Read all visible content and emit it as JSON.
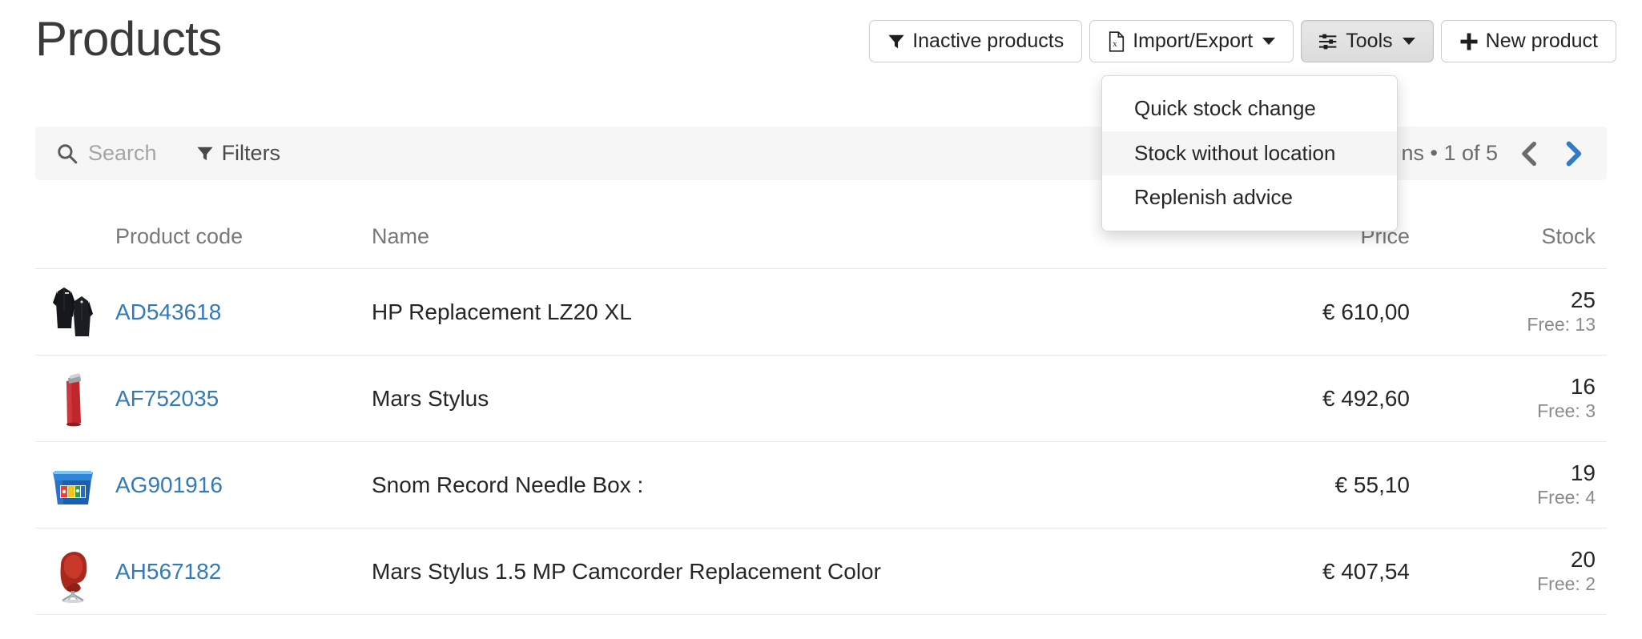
{
  "header": {
    "title": "Products",
    "buttons": [
      {
        "label": "Inactive products",
        "icon": "filter-icon"
      },
      {
        "label": "Import/Export",
        "icon": "excel-file-icon",
        "caret": true
      },
      {
        "label": "Tools",
        "icon": "sliders-icon",
        "caret": true,
        "active": true
      },
      {
        "label": "New product",
        "icon": "plus-icon"
      }
    ]
  },
  "tools_menu": {
    "items": [
      {
        "label": "Quick stock change",
        "hover": false
      },
      {
        "label": "Stock without location",
        "hover": true
      },
      {
        "label": "Replenish advice",
        "hover": false
      }
    ]
  },
  "toolbar": {
    "search_placeholder": "Search",
    "search_value": "",
    "search_icon": "search-icon",
    "filters_label": "Filters",
    "filters_icon": "filter-icon",
    "pager_text": "ns • 1 of 5",
    "prev_icon": "chevron-left-icon",
    "next_icon": "chevron-right-icon",
    "prev_color": "#6b6b6b",
    "next_color": "#2f7cc4"
  },
  "table": {
    "columns": [
      "",
      "Product code",
      "Name",
      "Price",
      "Stock"
    ],
    "rows": [
      {
        "thumb": "black-jackets-thumbnail",
        "code": "AD543618",
        "name": "HP Replacement LZ20 XL",
        "price": "€ 610,00",
        "stock": "25",
        "free": "Free: 13"
      },
      {
        "thumb": "red-tumbler-thumbnail",
        "code": "AF752035",
        "name": "Mars Stylus",
        "price": "€ 492,60",
        "stock": "16",
        "free": "Free: 3"
      },
      {
        "thumb": "blue-storage-box-thumbnail",
        "code": "AG901916",
        "name": "Snom Record Needle Box :",
        "price": "€ 55,10",
        "stock": "19",
        "free": "Free: 4"
      },
      {
        "thumb": "red-egg-chair-thumbnail",
        "code": "AH567182",
        "name": "Mars Stylus 1.5 MP Camcorder Replacement Color",
        "price": "€ 407,54",
        "stock": "20",
        "free": "Free: 2"
      }
    ]
  },
  "colors": {
    "link": "#337ab7",
    "toolbar_bg": "#f6f6f6",
    "accent_next": "#2f7cc4",
    "text": "#262626",
    "muted": "#8b8b8b"
  }
}
